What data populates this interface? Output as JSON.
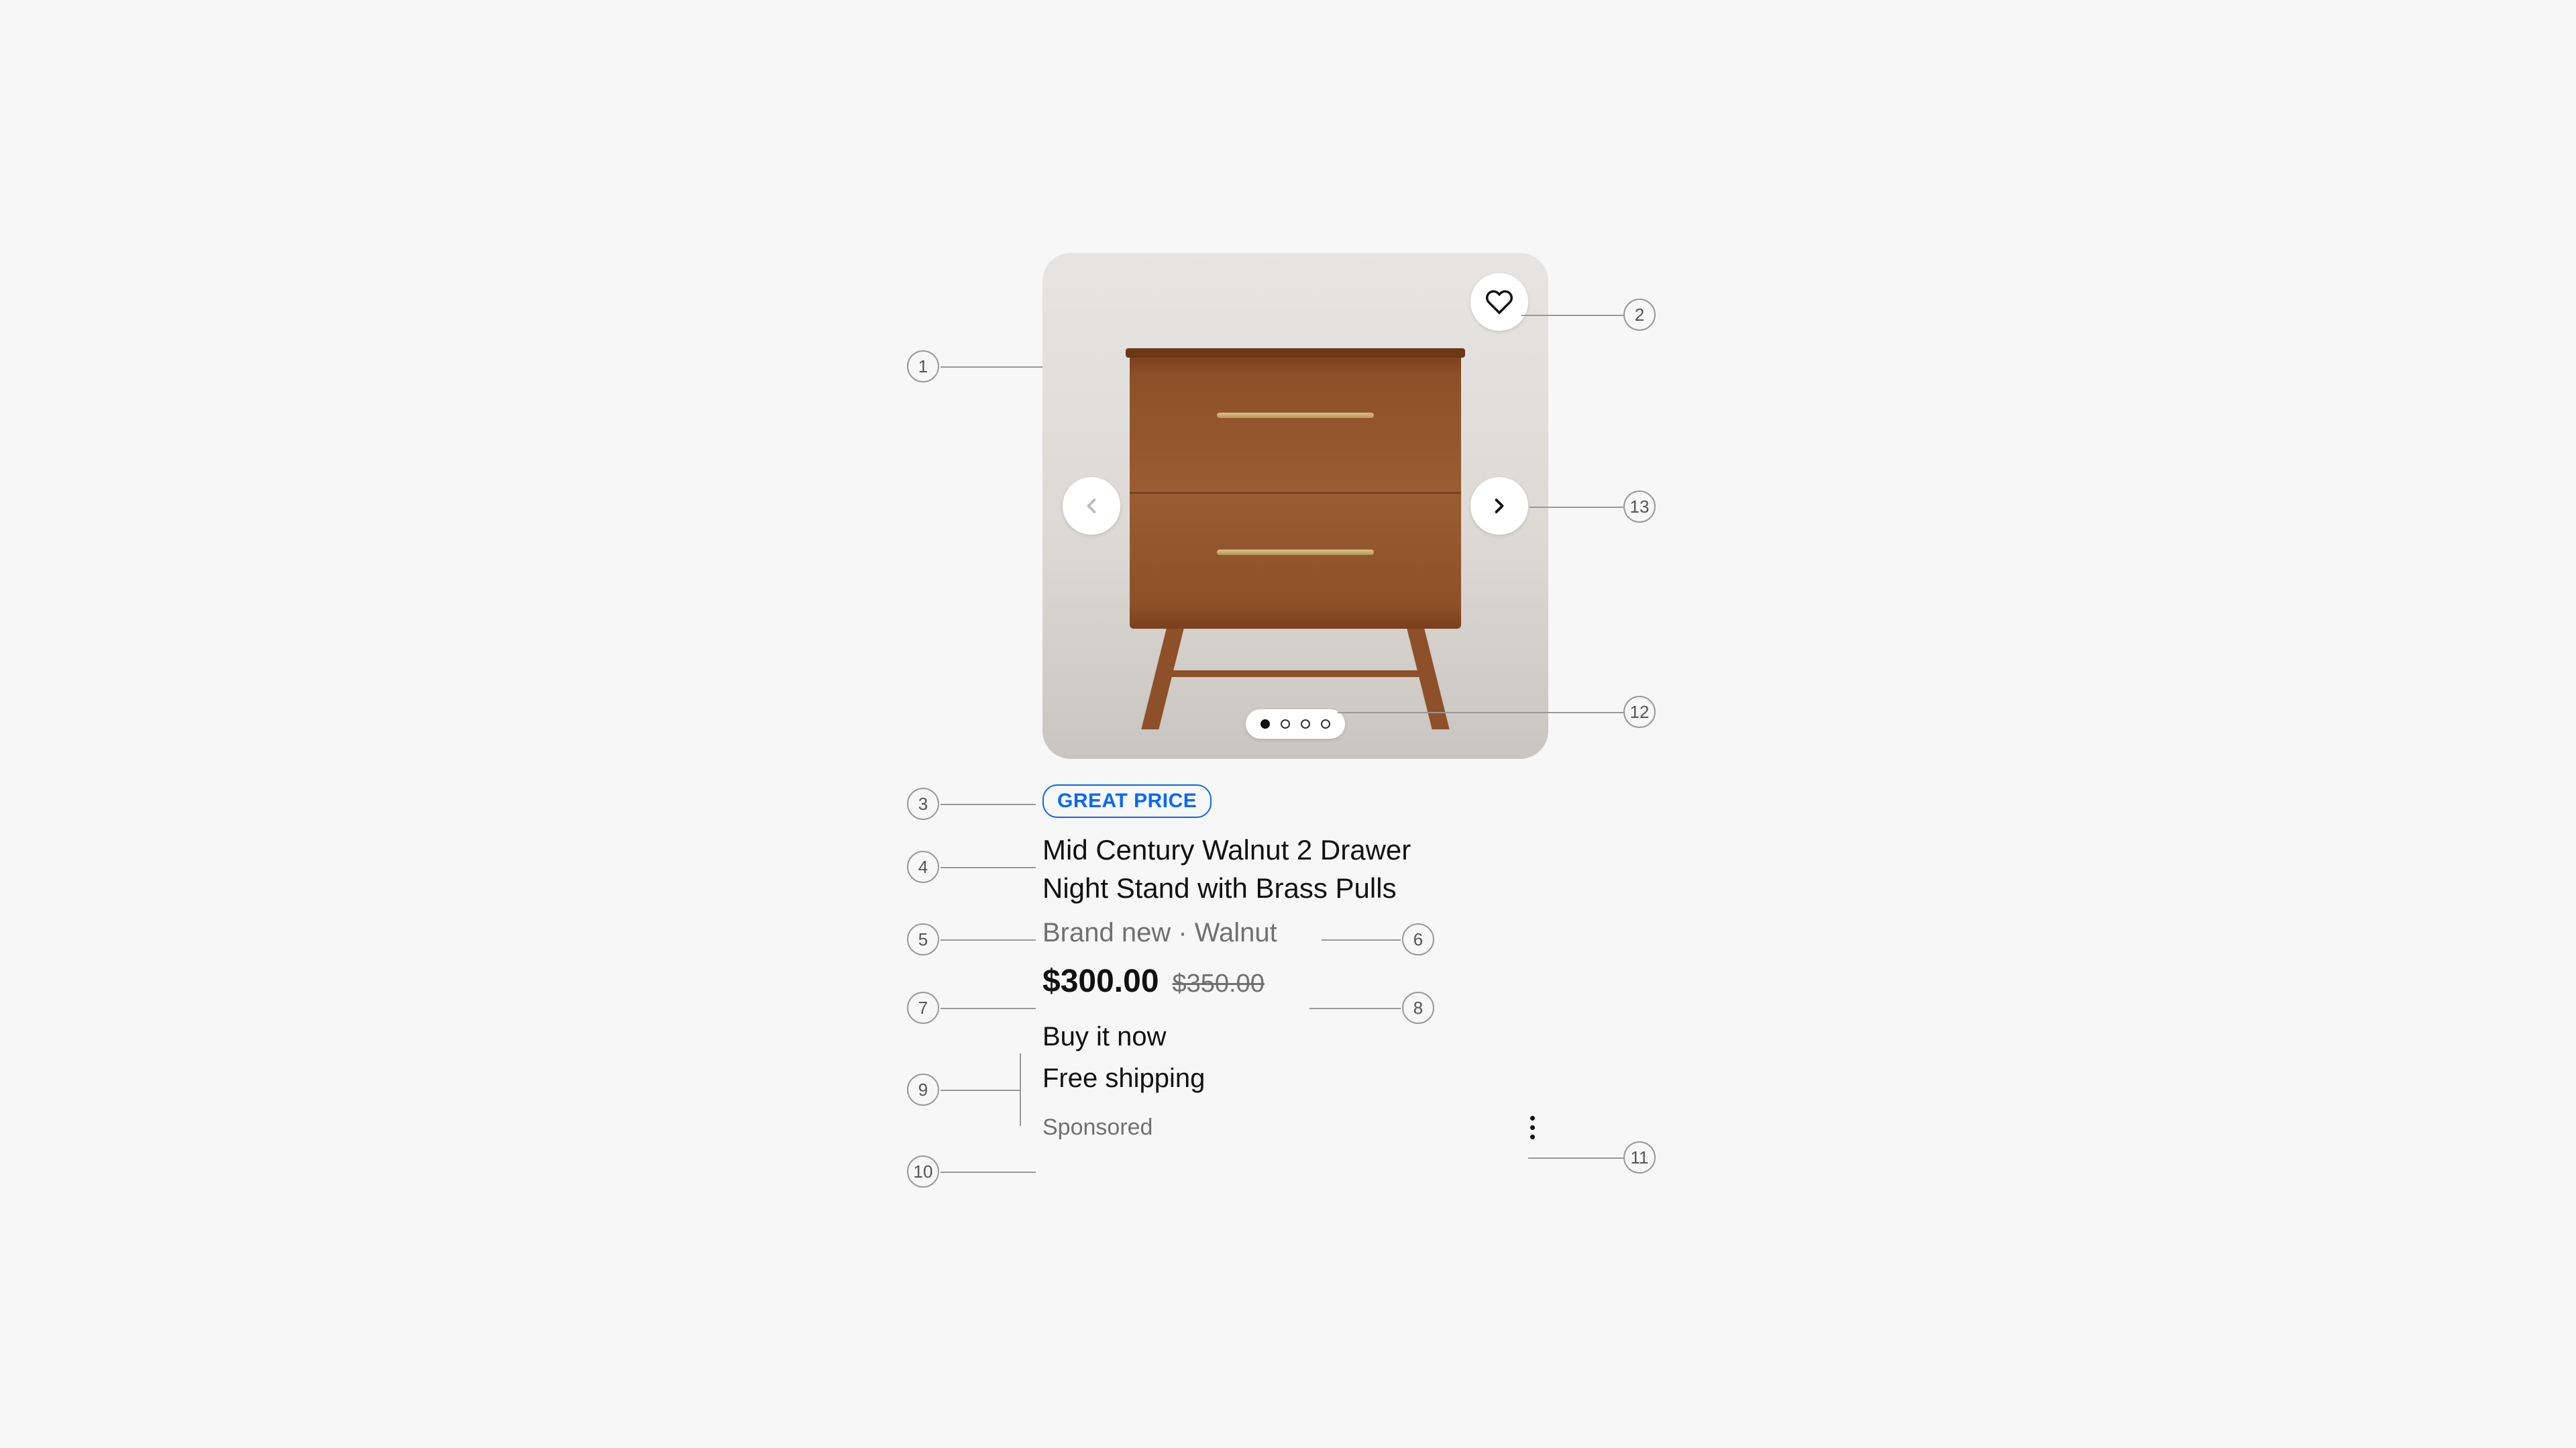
{
  "product": {
    "badge": "GREAT PRICE",
    "title_line1": "Mid Century Walnut 2 Drawer",
    "title_line2": "Night Stand with Brass Pulls",
    "condition": "Brand new",
    "variant": "Walnut",
    "price": "$300.00",
    "original_price": "$350.00",
    "buy_label": "Buy it now",
    "shipping_label": "Free shipping",
    "sponsored_label": "Sponsored",
    "separator": " · "
  },
  "annotations": {
    "n1": "1",
    "n2": "2",
    "n3": "3",
    "n4": "4",
    "n5": "5",
    "n6": "6",
    "n7": "7",
    "n8": "8",
    "n9": "9",
    "n10": "10",
    "n11": "11",
    "n12": "12",
    "n13": "13"
  }
}
